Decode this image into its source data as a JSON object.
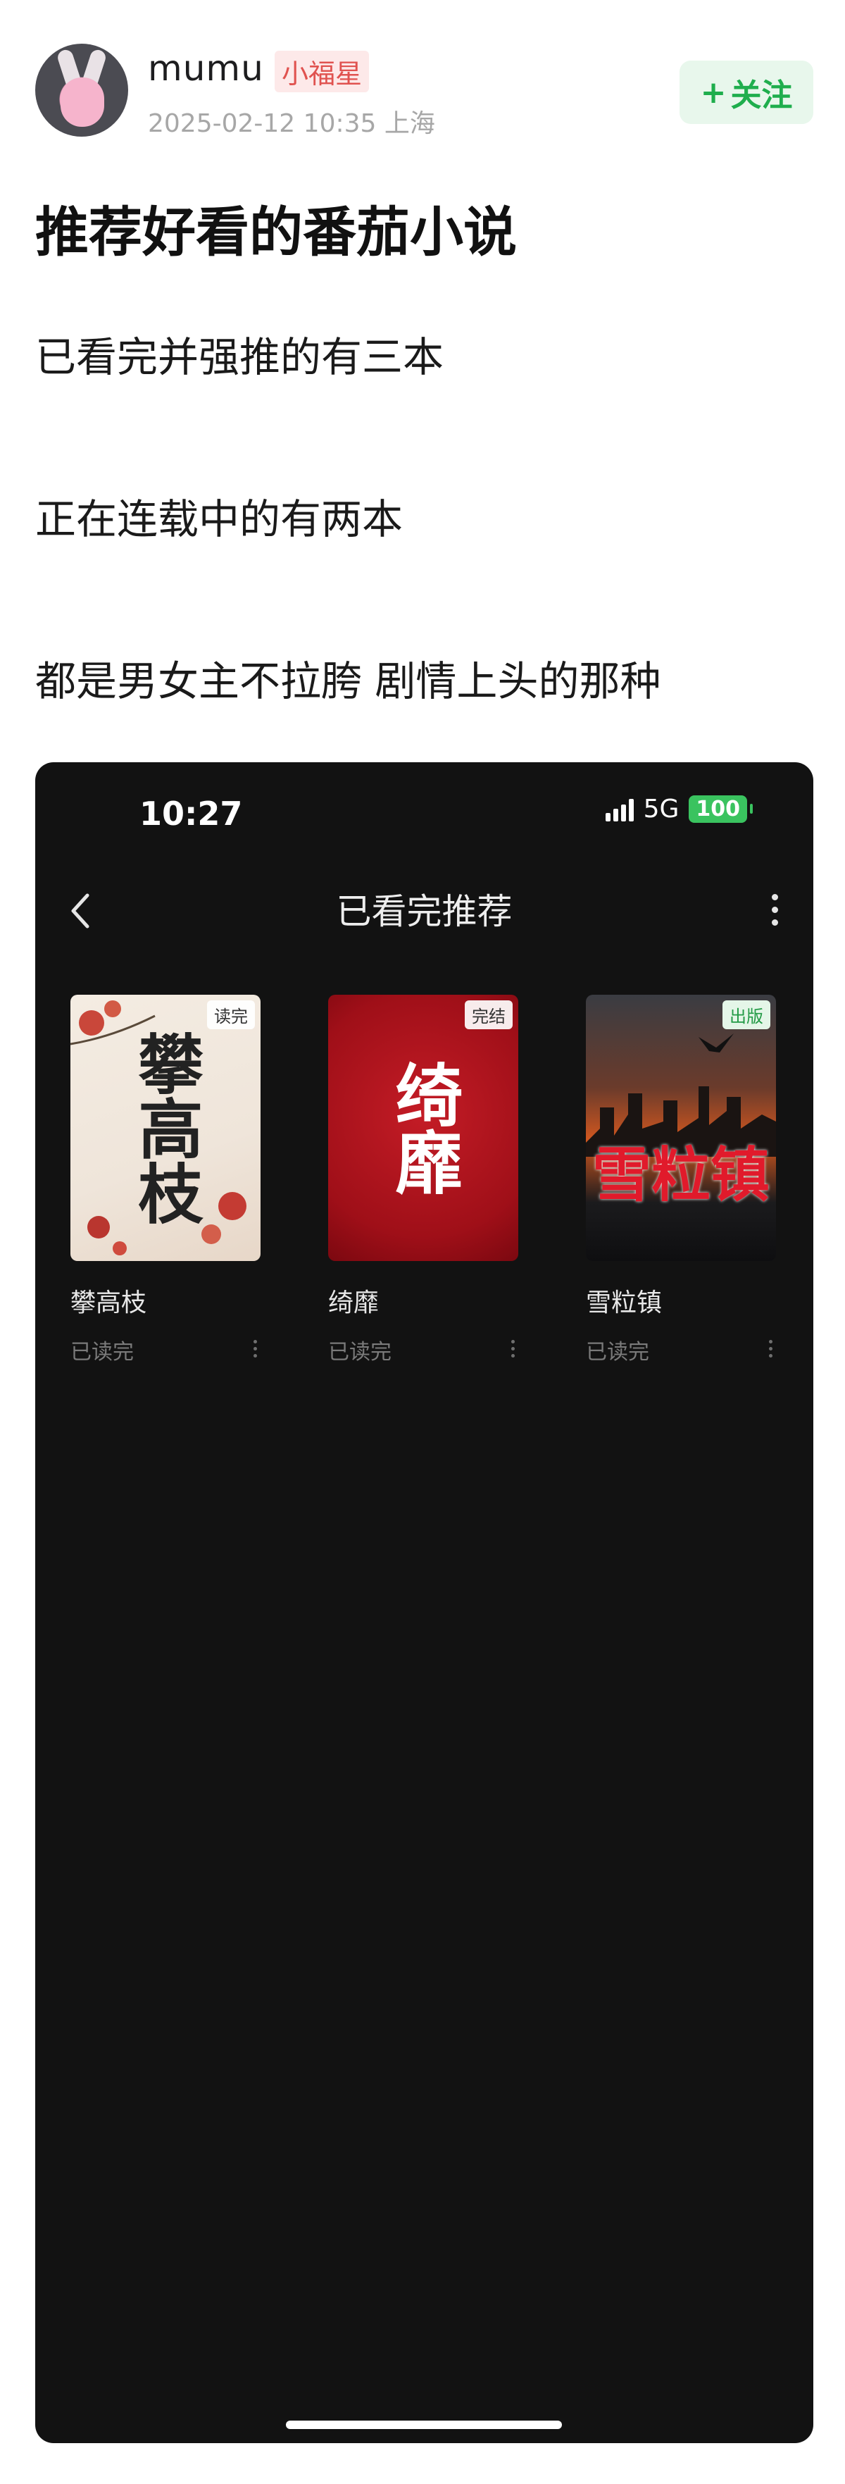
{
  "post": {
    "username": "mumu",
    "badge": "小福星",
    "meta": "2025-02-12 10:35  上海",
    "follow_label": "关注",
    "follow_plus": "+",
    "title": "推荐好看的番茄小说",
    "lines": [
      "已看完并强推的有三本",
      "正在连载中的有两本",
      "都是男女主不拉胯 剧情上头的那种"
    ]
  },
  "screenshot": {
    "status": {
      "time": "10:27",
      "network": "5G",
      "battery": "100"
    },
    "nav": {
      "back_icon": "chevron-left-icon",
      "title": "已看完推荐",
      "more_icon": "more-vertical-icon"
    },
    "books": [
      {
        "name": "攀高枝",
        "status": "已读完",
        "tag": "读完",
        "cover_text": "攀高枝"
      },
      {
        "name": "绮靡",
        "status": "已读完",
        "tag": "完结",
        "cover_text": "绮靡"
      },
      {
        "name": "雪粒镇",
        "status": "已读完",
        "tag": "出版",
        "cover_text": "雪粒镇"
      }
    ]
  },
  "colors": {
    "follow_green": "#1fae4d",
    "badge_red": "#e0524f",
    "battery_green": "#3ac35f",
    "phone_bg": "#121212"
  }
}
